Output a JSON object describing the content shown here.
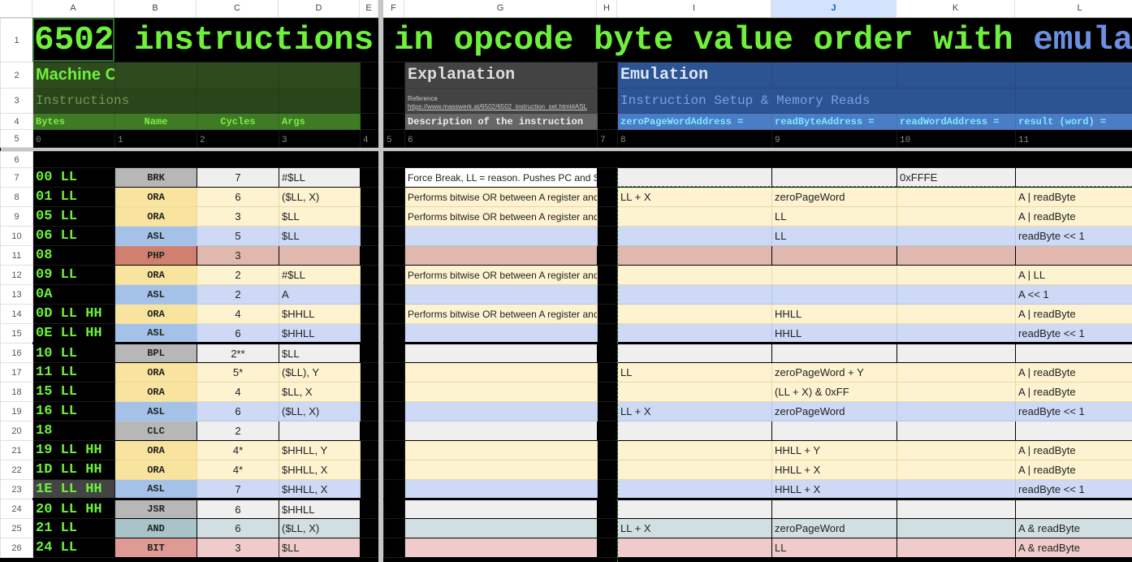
{
  "columns": [
    "A",
    "B",
    "C",
    "D",
    "E",
    "F",
    "G",
    "H",
    "I",
    "J",
    "K",
    "L"
  ],
  "title": {
    "main": "6502 instructions in opcode byte value order with ",
    "accent": "emula"
  },
  "machine_code": {
    "heading": "Machine Code",
    "subheading": "Instructions",
    "col_bytes": "Bytes",
    "col_name": "Name",
    "col_cycles": "Cycles",
    "col_args": "Args"
  },
  "explanation": {
    "heading": "Explanation",
    "reference_label": "Reference",
    "reference_link": "https://www.masswerk.at/6502/6502_instruction_set.html#ASL",
    "col_description": "Description of the instruction"
  },
  "emulation": {
    "heading": "Emulation",
    "subheading": "Instruction Setup & Memory Reads",
    "col_zp": "zeroPageWordAddress =",
    "col_rb": "readByteAddress =",
    "col_rw": "readWordAddress =",
    "col_result": "result (word) ="
  },
  "column_indices": [
    "0",
    "1",
    "2",
    "3",
    "4",
    "5",
    "6",
    "7",
    "8",
    "9",
    "10",
    "11"
  ],
  "colors": {
    "gray": [
      "#b7b7b7",
      "#efefef"
    ],
    "yellow": [
      "#f8e49e",
      "#fdf3d0"
    ],
    "blue": [
      "#a4c2e8",
      "#cdd9f5"
    ],
    "red": [
      "#d08070",
      "#e0b8ae"
    ],
    "teal": [
      "#a8c4c8",
      "#d2dfe2"
    ],
    "pink": [
      "#e09a96",
      "#efcccb"
    ]
  },
  "rows": [
    {
      "num": "7",
      "bytes": "00 LL",
      "name": "BRK",
      "cycles": "7",
      "args": "#$LL",
      "desc": "Force Break, LL = reason. Pushes PC and S",
      "zp": "",
      "rb": "",
      "rw": "0xFFFE",
      "res": "",
      "cat": "gray"
    },
    {
      "num": "8",
      "bytes": "01 LL",
      "name": "ORA",
      "cycles": "6",
      "args": "($LL, X)",
      "desc": "Performs bitwise OR between A register and",
      "zp": "LL + X",
      "rb": "zeroPageWord",
      "rw": "",
      "res": "A | readByte",
      "cat": "yellow"
    },
    {
      "num": "9",
      "bytes": "05 LL",
      "name": "ORA",
      "cycles": "3",
      "args": "$LL",
      "desc": "Performs bitwise OR between A register and",
      "zp": "",
      "rb": "LL",
      "rw": "",
      "res": "A | readByte",
      "cat": "yellow"
    },
    {
      "num": "10",
      "bytes": "06 LL",
      "name": "ASL",
      "cycles": "5",
      "args": "$LL",
      "desc": "",
      "zp": "",
      "rb": "LL",
      "rw": "",
      "res": "readByte << 1",
      "cat": "blue"
    },
    {
      "num": "11",
      "bytes": "08",
      "name": "PHP",
      "cycles": "3",
      "args": "",
      "desc": "",
      "zp": "",
      "rb": "",
      "rw": "",
      "res": "",
      "cat": "red"
    },
    {
      "num": "12",
      "bytes": "09 LL",
      "name": "ORA",
      "cycles": "2",
      "args": "#$LL",
      "desc": "Performs bitwise OR between A register and",
      "zp": "",
      "rb": "",
      "rw": "",
      "res": "A | LL",
      "cat": "yellow"
    },
    {
      "num": "13",
      "bytes": "0A",
      "name": "ASL",
      "cycles": "2",
      "args": "A",
      "desc": "",
      "zp": "",
      "rb": "",
      "rw": "",
      "res": "A << 1",
      "cat": "blue"
    },
    {
      "num": "14",
      "bytes": "0D LL HH",
      "name": "ORA",
      "cycles": "4",
      "args": "$HHLL",
      "desc": "Performs bitwise OR between A register and",
      "zp": "",
      "rb": "HHLL",
      "rw": "",
      "res": "A | readByte",
      "cat": "yellow"
    },
    {
      "num": "15",
      "bytes": "0E LL HH",
      "name": "ASL",
      "cycles": "6",
      "args": "$HHLL",
      "desc": "",
      "zp": "",
      "rb": "HHLL",
      "rw": "",
      "res": "readByte << 1",
      "cat": "blue",
      "sep": true
    },
    {
      "num": "16",
      "bytes": "10 LL",
      "name": "BPL",
      "cycles": "2**",
      "args": "$LL",
      "desc": "",
      "zp": "",
      "rb": "",
      "rw": "",
      "res": "",
      "cat": "gray"
    },
    {
      "num": "17",
      "bytes": "11 LL",
      "name": "ORA",
      "cycles": "5*",
      "args": "($LL), Y",
      "desc": "",
      "zp": "LL",
      "rb": "zeroPageWord + Y",
      "rw": "",
      "res": "A | readByte",
      "cat": "yellow"
    },
    {
      "num": "18",
      "bytes": "15 LL",
      "name": "ORA",
      "cycles": "4",
      "args": "$LL, X",
      "desc": "",
      "zp": "",
      "rb": "(LL + X) & 0xFF",
      "rw": "",
      "res": "A | readByte",
      "cat": "yellow"
    },
    {
      "num": "19",
      "bytes": "16 LL",
      "name": "ASL",
      "cycles": "6",
      "args": "($LL, X)",
      "desc": "",
      "zp": "LL + X",
      "rb": "zeroPageWord",
      "rw": "",
      "res": "readByte << 1",
      "cat": "blue"
    },
    {
      "num": "20",
      "bytes": "18",
      "name": "CLC",
      "cycles": "2",
      "args": "",
      "desc": "",
      "zp": "",
      "rb": "",
      "rw": "",
      "res": "",
      "cat": "gray"
    },
    {
      "num": "21",
      "bytes": "19 LL HH",
      "name": "ORA",
      "cycles": "4*",
      "args": "$HHLL, Y",
      "desc": "",
      "zp": "",
      "rb": "HHLL + Y",
      "rw": "",
      "res": "A | readByte",
      "cat": "yellow"
    },
    {
      "num": "22",
      "bytes": "1D LL HH",
      "name": "ORA",
      "cycles": "4*",
      "args": "$HHLL, X",
      "desc": "",
      "zp": "",
      "rb": "HHLL + X",
      "rw": "",
      "res": "A | readByte",
      "cat": "yellow"
    },
    {
      "num": "23",
      "bytes": "1E LL HH",
      "name": "ASL",
      "cycles": "7",
      "args": "$HHLL, X",
      "desc": "",
      "zp": "",
      "rb": "HHLL + X",
      "rw": "",
      "res": "readByte << 1",
      "cat": "blue",
      "sep": true
    },
    {
      "num": "24",
      "bytes": "20 LL HH",
      "name": "JSR",
      "cycles": "6",
      "args": "$HHLL",
      "desc": "",
      "zp": "",
      "rb": "",
      "rw": "",
      "res": "",
      "cat": "gray"
    },
    {
      "num": "25",
      "bytes": "21 LL",
      "name": "AND",
      "cycles": "6",
      "args": "($LL, X)",
      "desc": "",
      "zp": "LL + X",
      "rb": "zeroPageWord",
      "rw": "",
      "res": "A & readByte",
      "cat": "teal"
    },
    {
      "num": "26",
      "bytes": "24 LL",
      "name": "BIT",
      "cycles": "3",
      "args": "$LL",
      "desc": "",
      "zp": "",
      "rb": "LL",
      "rw": "",
      "res": "A & readByte",
      "cat": "pink"
    }
  ],
  "row_numbers": [
    "1",
    "2",
    "3",
    "4",
    "5",
    "6"
  ]
}
